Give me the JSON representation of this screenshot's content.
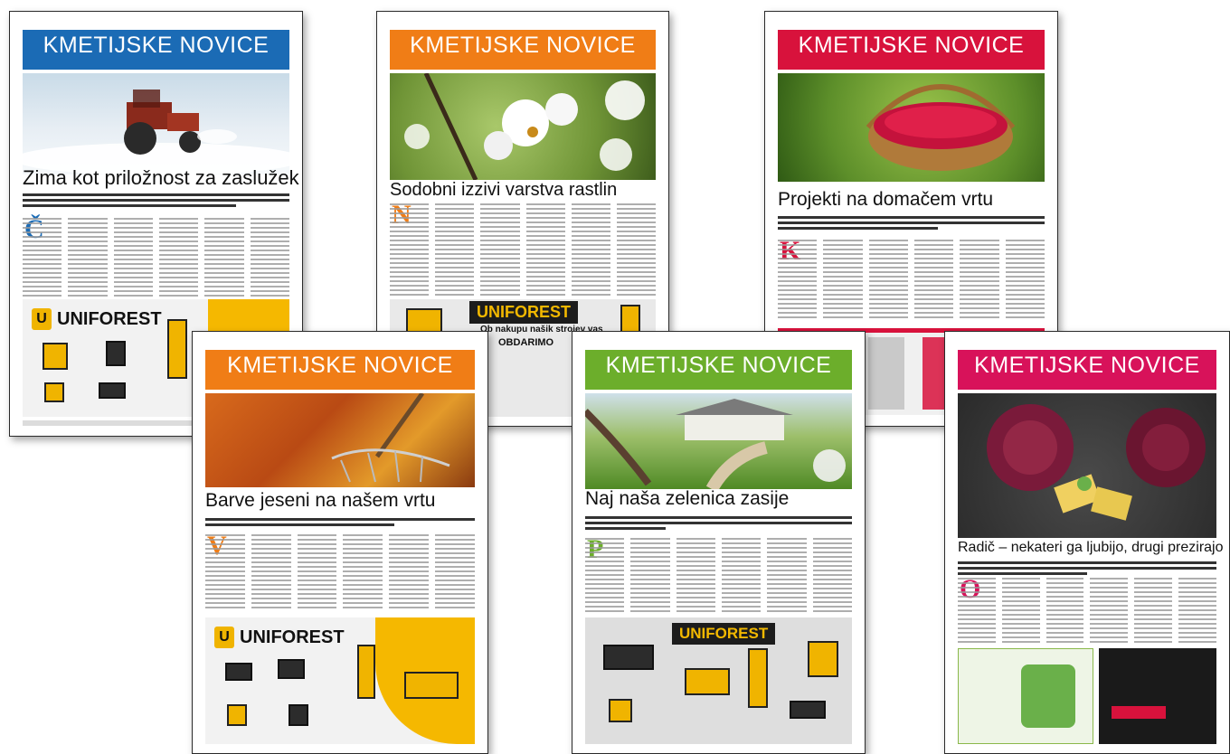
{
  "pages": [
    {
      "masthead": "KMETIJSKE NOVICE",
      "color": "#1b6bb5",
      "headline": "Zima kot priložnost za zaslužek",
      "dropcap": "Č",
      "ad_brand": "UNIFOREST"
    },
    {
      "masthead": "KMETIJSKE NOVICE",
      "color": "#f07d16",
      "headline": "Sodobni izzivi varstva rastlin",
      "dropcap": "N",
      "ad_brand": "UNIFOREST",
      "ad_line1": "Ob nakupu našik strojev vas",
      "ad_line2": "OBDARIMO"
    },
    {
      "masthead": "KMETIJSKE NOVICE",
      "color": "#d8123c",
      "headline": "Projekti na domačem vrtu",
      "dropcap": "K"
    },
    {
      "masthead": "KMETIJSKE NOVICE",
      "color": "#f07d16",
      "headline": "Barve jeseni na našem vrtu",
      "dropcap": "V",
      "ad_brand": "UNIFOREST"
    },
    {
      "masthead": "KMETIJSKE NOVICE",
      "color": "#6cae2b",
      "headline": "Naj naša zelenica zasije",
      "dropcap": "P",
      "ad_brand": "UNIFOREST"
    },
    {
      "masthead": "KMETIJSKE NOVICE",
      "color": "#d8125a",
      "headline": "Radič – nekateri ga ljubijo, drugi prezirajo",
      "dropcap": "O"
    }
  ]
}
